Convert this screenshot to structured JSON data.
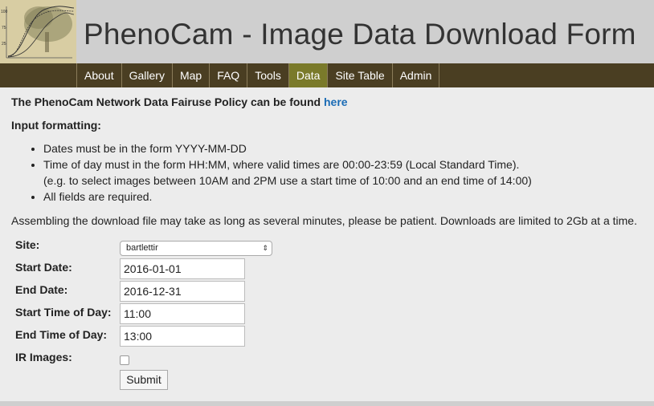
{
  "header": {
    "title": "PhenoCam - Image Data Download Form",
    "logo_icon": "phenocam-logo-chart"
  },
  "nav": {
    "items": [
      {
        "label": "About"
      },
      {
        "label": "Gallery"
      },
      {
        "label": "Map"
      },
      {
        "label": "FAQ"
      },
      {
        "label": "Tools"
      },
      {
        "label": "Data"
      },
      {
        "label": "Site Table"
      },
      {
        "label": "Admin"
      }
    ],
    "active": "Data"
  },
  "intro": {
    "policy_text": "The PhenoCam Network Data Fairuse Policy can be found ",
    "policy_link": "here",
    "input_heading": "Input formatting:",
    "bullets": {
      "date": "Dates must be in the form YYYY-MM-DD",
      "time": "Time of day must in the form HH:MM, where valid times are 00:00-23:59 (Local Standard Time).",
      "time_example": "(e.g. to select images between 10AM and 2PM use a start time of 10:00 and an end time of 14:00)",
      "required": "All fields are required."
    },
    "assemble_note": "Assembling the download file may take as long as several minutes, please be patient. Downloads are limited to 2Gb at a time."
  },
  "form": {
    "site_label": "Site:",
    "site_value": "bartlettir",
    "start_date_label": "Start Date:",
    "start_date_value": "2016-01-01",
    "end_date_label": "End Date:",
    "end_date_value": "2016-12-31",
    "start_time_label": "Start Time of Day:",
    "start_time_value": "11:00",
    "end_time_label": "End Time of Day:",
    "end_time_value": "13:00",
    "ir_label": "IR Images:",
    "ir_checked": false,
    "submit_label": "Submit"
  },
  "colors": {
    "navbar": "#4a3e22",
    "active_tab": "#7a7a2a",
    "link": "#1a6bb5",
    "header_bg": "#cfcfcf"
  }
}
